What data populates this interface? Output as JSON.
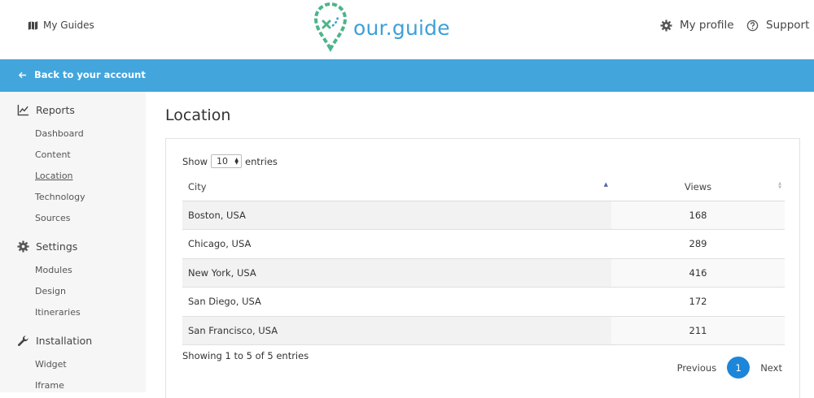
{
  "header": {
    "my_guides": "My Guides",
    "logo_text": "our.guide",
    "my_profile": "My profile",
    "support": "Support"
  },
  "subnav": {
    "back_label": "Back to your account"
  },
  "sidebar": {
    "reports": {
      "label": "Reports",
      "items": [
        "Dashboard",
        "Content",
        "Location",
        "Technology",
        "Sources"
      ]
    },
    "settings": {
      "label": "Settings",
      "items": [
        "Modules",
        "Design",
        "Itineraries"
      ]
    },
    "installation": {
      "label": "Installation",
      "items": [
        "Widget",
        "Iframe"
      ]
    },
    "active_item": "Location"
  },
  "main": {
    "title": "Location",
    "show_label": "Show",
    "entries_value": "10",
    "entries_label": "entries",
    "columns": [
      "City",
      "Views"
    ],
    "rows": [
      {
        "city": "Boston, USA",
        "views": "168"
      },
      {
        "city": "Chicago, USA",
        "views": "289"
      },
      {
        "city": "New York, USA",
        "views": "416"
      },
      {
        "city": "San Diego, USA",
        "views": "172"
      },
      {
        "city": "San Francisco, USA",
        "views": "211"
      }
    ],
    "info": "Showing 1 to 5 of 5 entries",
    "pager": {
      "previous": "Previous",
      "current": "1",
      "next": "Next"
    }
  },
  "colors": {
    "accent": "#42a5dc",
    "logo": "#3ea0d8",
    "logo_pin": "#4bb58a",
    "page_button": "#1d86d8"
  },
  "icons": {
    "my_guides": "map-icon",
    "profile": "gear-icon",
    "support": "question-circle-icon",
    "back": "arrow-left-icon",
    "reports": "line-chart-icon",
    "settings": "gear-icon",
    "installation": "wrench-icon"
  }
}
